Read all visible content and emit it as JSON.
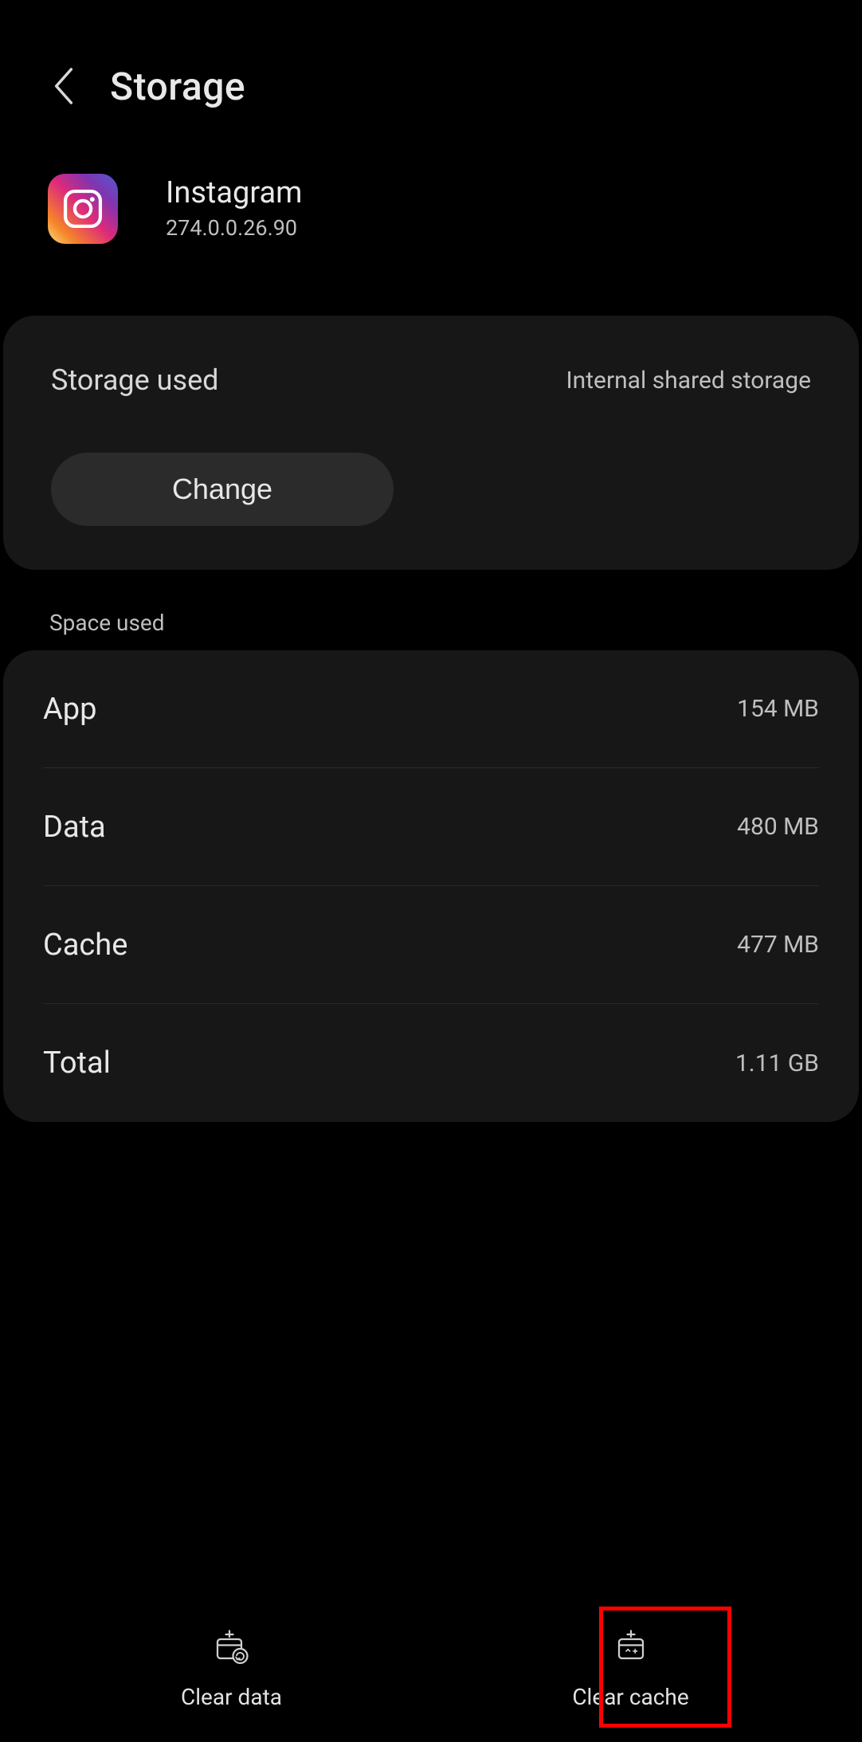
{
  "header": {
    "title": "Storage"
  },
  "app": {
    "name": "Instagram",
    "version": "274.0.0.26.90"
  },
  "storage_card": {
    "label": "Storage used",
    "value": "Internal shared storage",
    "change_label": "Change"
  },
  "section_heading": "Space used",
  "space_rows": [
    {
      "label": "App",
      "value": "154 MB"
    },
    {
      "label": "Data",
      "value": "480 MB"
    },
    {
      "label": "Cache",
      "value": "477 MB"
    },
    {
      "label": "Total",
      "value": "1.11 GB"
    }
  ],
  "bottom_bar": {
    "clear_data": "Clear data",
    "clear_cache": "Clear cache"
  }
}
